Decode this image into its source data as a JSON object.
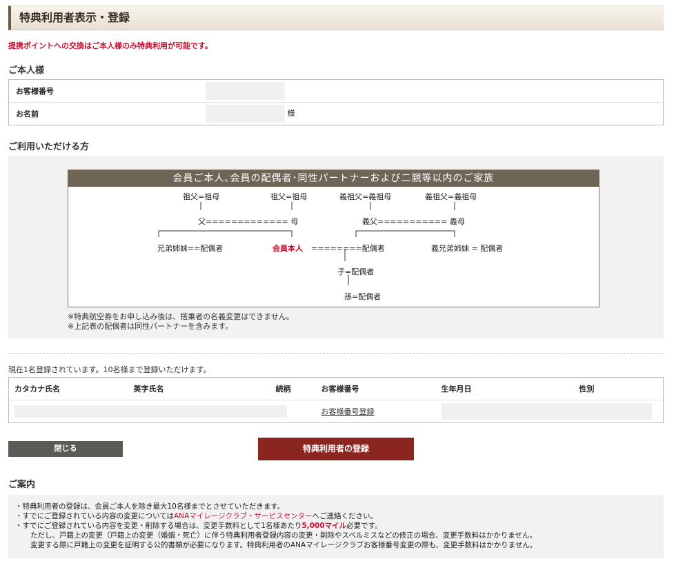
{
  "page_title": "特典利用者表示・登録",
  "notice": "提携ポイントへの交換はご本人様のみ特典利用が可能です。",
  "self_section": {
    "heading": "ご本人様",
    "customer_no_label": "お客様番号",
    "name_label": "お名前",
    "name_suffix": "様"
  },
  "eligible_section": {
    "heading": "ご利用いただける方",
    "diagram_title": "会員ご本人､会員の配偶者･同性パートナーおよび二親等以内のご家族",
    "nodes": {
      "grandparents_1": "祖父=祖母",
      "grandparents_2": "祖父=祖母",
      "inlaw_grandparents_1": "義祖父=義祖母",
      "inlaw_grandparents_2": "義祖父=義祖母",
      "parents": "父============= 母",
      "inlaw_parents": "義父=========== 義母",
      "siblings": "兄弟姉妹==配偶者",
      "member": "会員本人",
      "member_spouse": "========配偶者",
      "inlaw_siblings": "義兄弟姉妹 = 配偶者",
      "child": "子=配偶者",
      "grandchild": "孫=配偶者"
    },
    "notes": [
      "※特典航空券をお申し込み後は、搭乗者の名義変更はできません。",
      "※上記表の配偶者は同性パートナーを含みます。"
    ]
  },
  "registered_count_text": "現在1名登録されています。10名様まで登録いただけます。",
  "users_table": {
    "headers": [
      "カタカナ氏名",
      "英字氏名",
      "続柄",
      "お客様番号",
      "生年月日",
      "性別"
    ],
    "register_link": "お客様番号登録"
  },
  "buttons": {
    "close": "閉じる",
    "register": "特典利用者の登録"
  },
  "guide": {
    "heading": "ご案内",
    "line1": "・特典利用者の登録は、会員ご本人を除き最大10名様までとさせていただきます。",
    "line2_a": "・すでにご登録されている内容の変更については",
    "line2_link": "ANAマイレージクラブ・サービスセンター",
    "line2_b": "へご連絡ください。",
    "line3_a": "・すでにご登録されている内容を変更・削除する場合は、変更手数料として1名様あたり",
    "line3_bold": "5,000マイル",
    "line3_b": "必要です。",
    "line4": "ただし、戸籍上の変更（戸籍上の変更（婚姻・死亡）に伴う特典利用者登録内容の変更・削除やスペルミスなどの修正の場合、変更手数料はかかりません。",
    "line5": "変更する際に戸籍上の変更を証明する公的書類が必要になります。特典利用者のANAマイレージクラブお客様番号変更の際も、変更手数料はかかりません。"
  },
  "colors": {
    "accent_red": "#c8102e",
    "register_button": "#8b2520",
    "close_button": "#5c5a55",
    "diagram_header": "#6e6556"
  }
}
